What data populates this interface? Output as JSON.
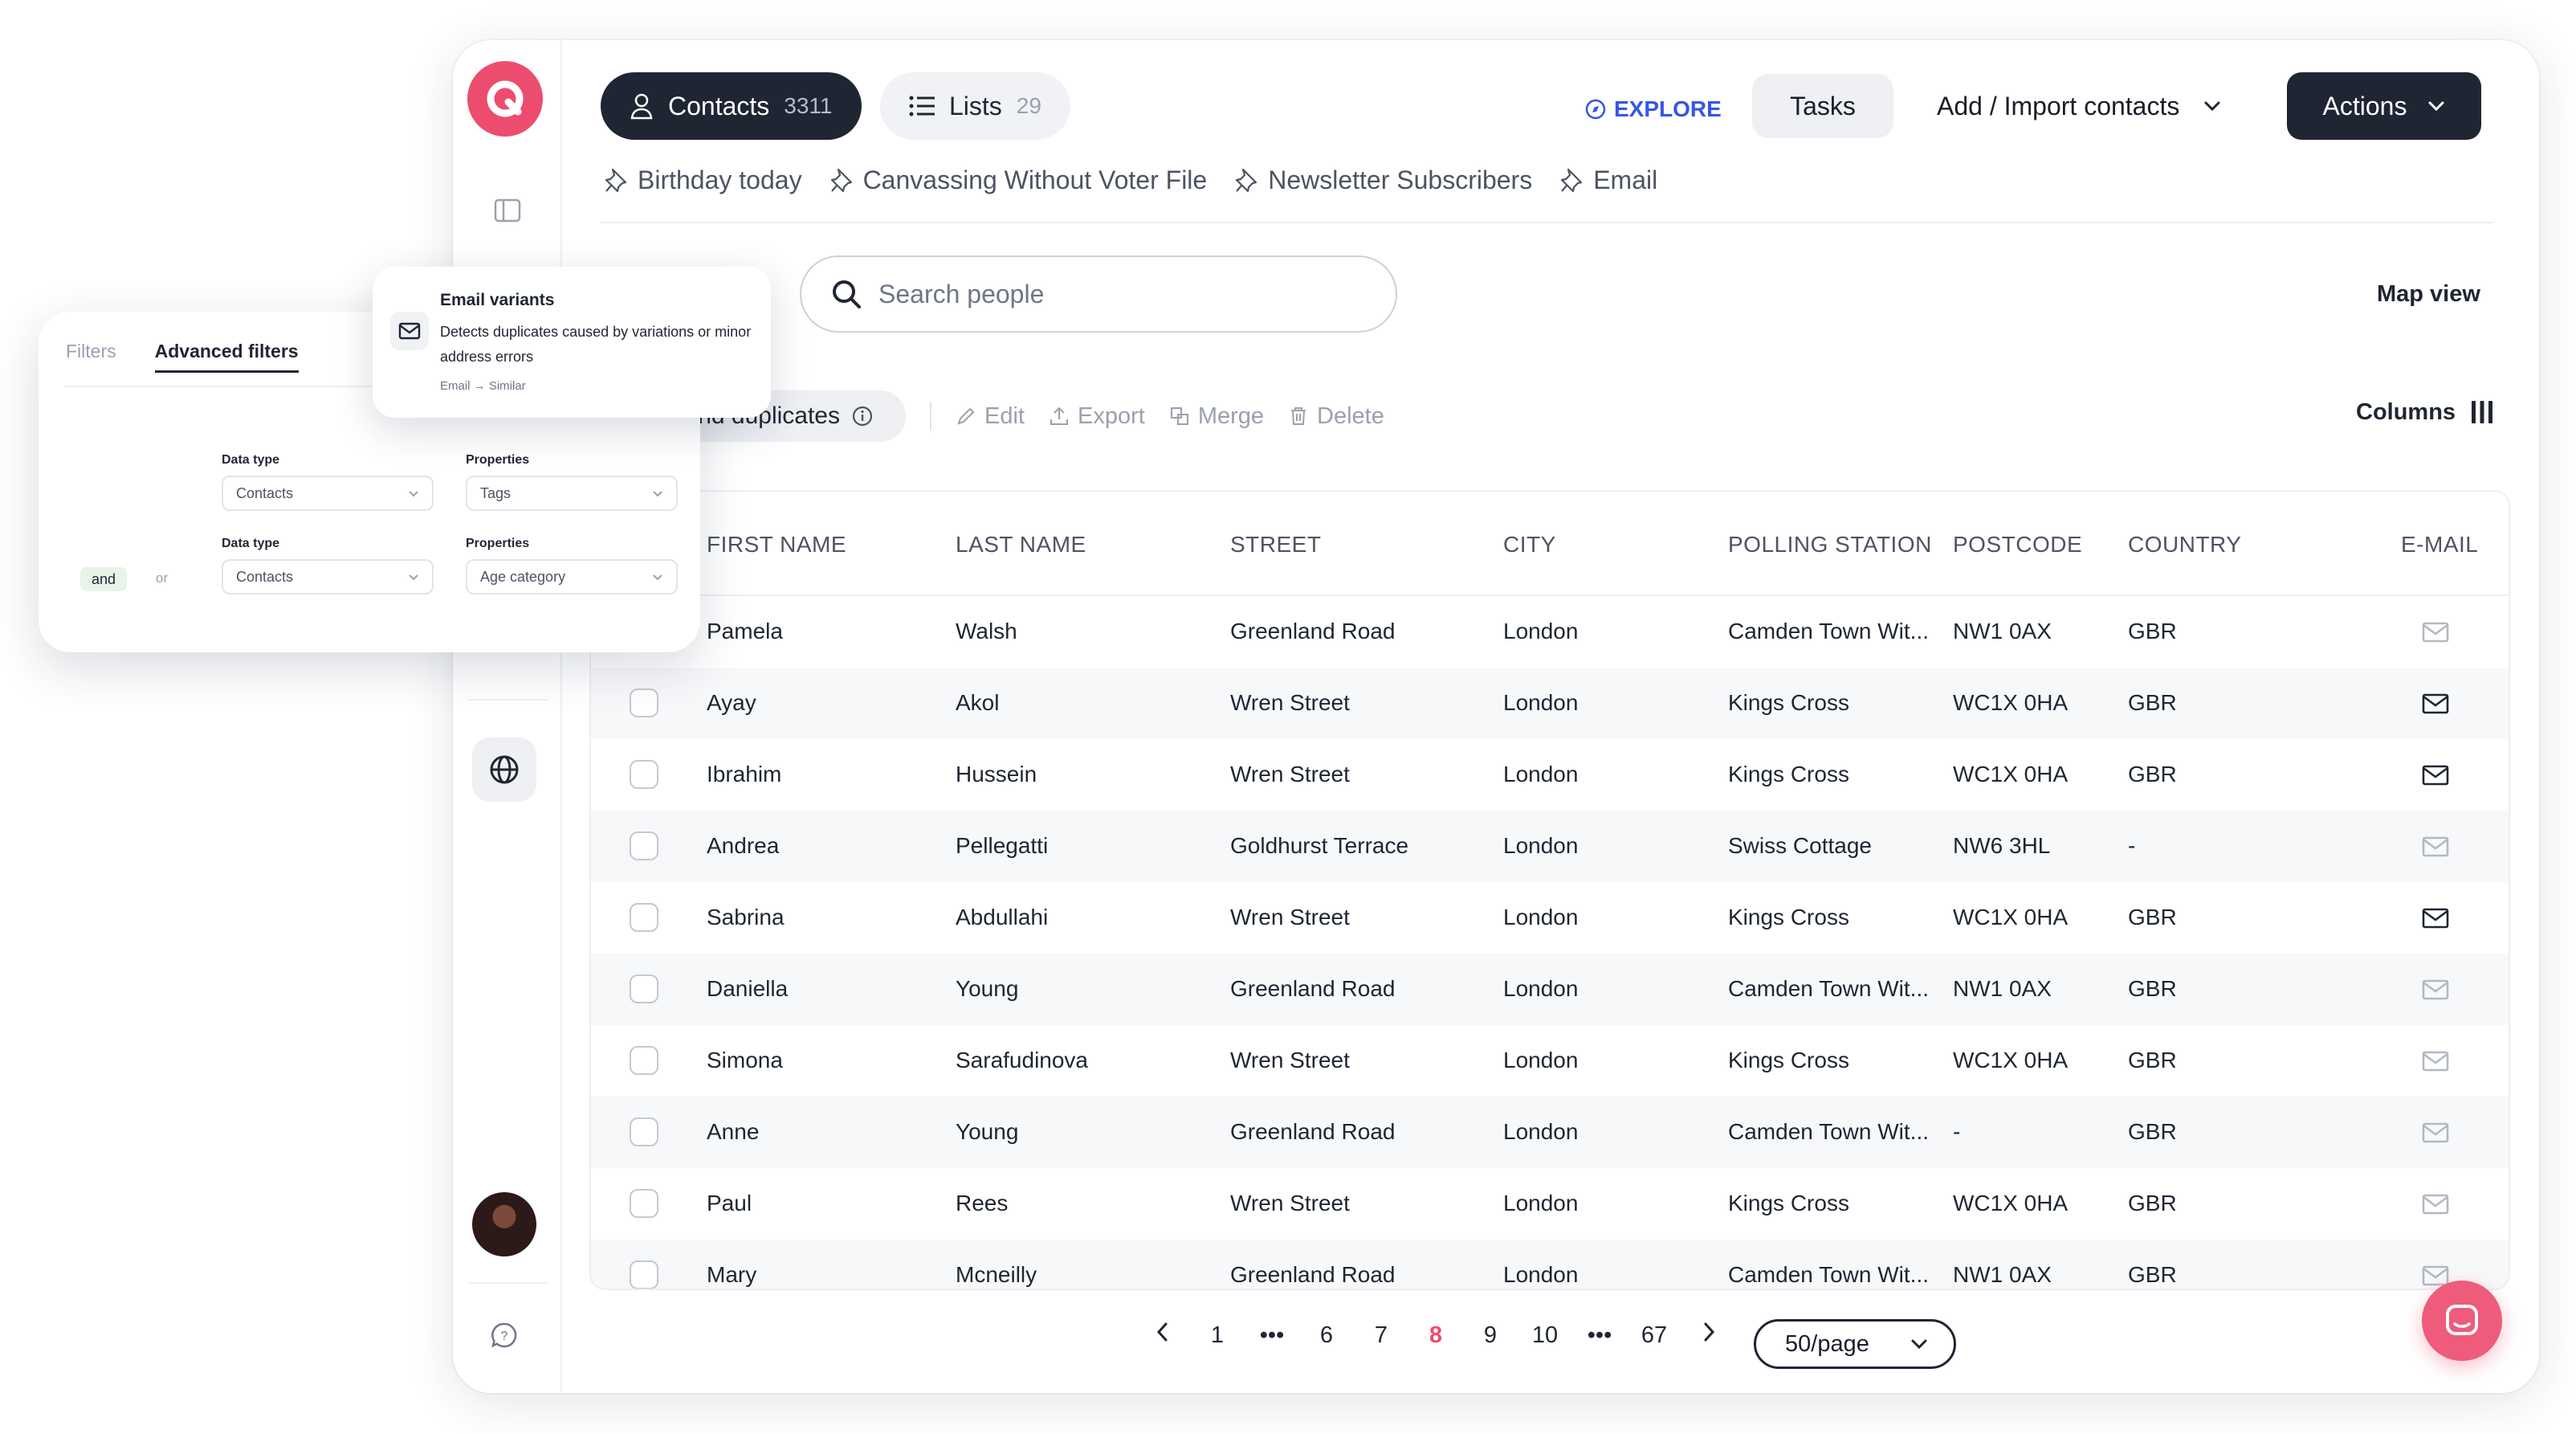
{
  "header": {
    "contacts_tab": {
      "label": "Contacts",
      "count": "3311"
    },
    "lists_tab": {
      "label": "Lists",
      "count": "29"
    },
    "explore_label": "EXPLORE",
    "tasks_label": "Tasks",
    "add_import_label": "Add / Import contacts",
    "actions_label": "Actions"
  },
  "shortcuts": [
    "Birthday today",
    "Canvassing Without Voter File",
    "Newsletter Subscribers",
    "Email"
  ],
  "search": {
    "placeholder": "Search people"
  },
  "map_view_label": "Map view",
  "toolbar": {
    "duplicates_label": "Find duplicates",
    "edit": "Edit",
    "export": "Export",
    "merge": "Merge",
    "delete": "Delete",
    "columns_label": "Columns"
  },
  "table": {
    "headers": [
      "FIRST NAME",
      "LAST NAME",
      "STREET",
      "CITY",
      "POLLING STATION",
      "POSTCODE",
      "COUNTRY",
      "E-MAIL"
    ],
    "rows": [
      {
        "first": "Pamela",
        "last": "Walsh",
        "street": "Greenland Road",
        "city": "London",
        "station": "Camden Town Wit...",
        "postcode": "NW1 0AX",
        "country": "GBR",
        "email_active": false
      },
      {
        "first": "Ayay",
        "last": "Akol",
        "street": "Wren Street",
        "city": "London",
        "station": "Kings Cross",
        "postcode": "WC1X 0HA",
        "country": "GBR",
        "email_active": true
      },
      {
        "first": "Ibrahim",
        "last": "Hussein",
        "street": "Wren Street",
        "city": "London",
        "station": "Kings Cross",
        "postcode": "WC1X 0HA",
        "country": "GBR",
        "email_active": true
      },
      {
        "first": "Andrea",
        "last": "Pellegatti",
        "street": "Goldhurst Terrace",
        "city": "London",
        "station": "Swiss Cottage",
        "postcode": "NW6 3HL",
        "country": "-",
        "email_active": false
      },
      {
        "first": "Sabrina",
        "last": "Abdullahi",
        "street": "Wren Street",
        "city": "London",
        "station": "Kings Cross",
        "postcode": "WC1X 0HA",
        "country": "GBR",
        "email_active": true
      },
      {
        "first": "Daniella",
        "last": "Young",
        "street": "Greenland Road",
        "city": "London",
        "station": "Camden Town Wit...",
        "postcode": "NW1 0AX",
        "country": "GBR",
        "email_active": false
      },
      {
        "first": "Simona",
        "last": "Sarafudinova",
        "street": "Wren Street",
        "city": "London",
        "station": "Kings Cross",
        "postcode": "WC1X 0HA",
        "country": "GBR",
        "email_active": false
      },
      {
        "first": "Anne",
        "last": "Young",
        "street": "Greenland Road",
        "city": "London",
        "station": "Camden Town Wit...",
        "postcode": "-",
        "country": "GBR",
        "email_active": false
      },
      {
        "first": "Paul",
        "last": "Rees",
        "street": "Wren Street",
        "city": "London",
        "station": "Kings Cross",
        "postcode": "WC1X 0HA",
        "country": "GBR",
        "email_active": false
      },
      {
        "first": "Mary",
        "last": "Mcneilly",
        "street": "Greenland Road",
        "city": "London",
        "station": "Camden Town Wit...",
        "postcode": "NW1 0AX",
        "country": "GBR",
        "email_active": false
      }
    ]
  },
  "pagination": {
    "pages": [
      "1",
      "•••",
      "6",
      "7",
      "8",
      "9",
      "10",
      "•••",
      "67"
    ],
    "current": "8",
    "per_page": "50/page"
  },
  "filter_card": {
    "tab_filters": "Filters",
    "tab_advanced": "Advanced filters",
    "row1": {
      "data_type_label": "Data type",
      "data_type_value": "Contacts",
      "properties_label": "Properties",
      "properties_value": "Tags"
    },
    "row2": {
      "data_type_label": "Data type",
      "data_type_value": "Contacts",
      "properties_label": "Properties",
      "properties_value": "Age category"
    },
    "and_label": "and",
    "or_label": "or"
  },
  "variant_card": {
    "title": "Email variants",
    "description": "Detects duplicates caused by variations or minor address errors",
    "footer": "Email → Similar"
  },
  "colors": {
    "brand": "#ec4d6e",
    "dark": "#1f2532",
    "explore": "#3556e6"
  }
}
